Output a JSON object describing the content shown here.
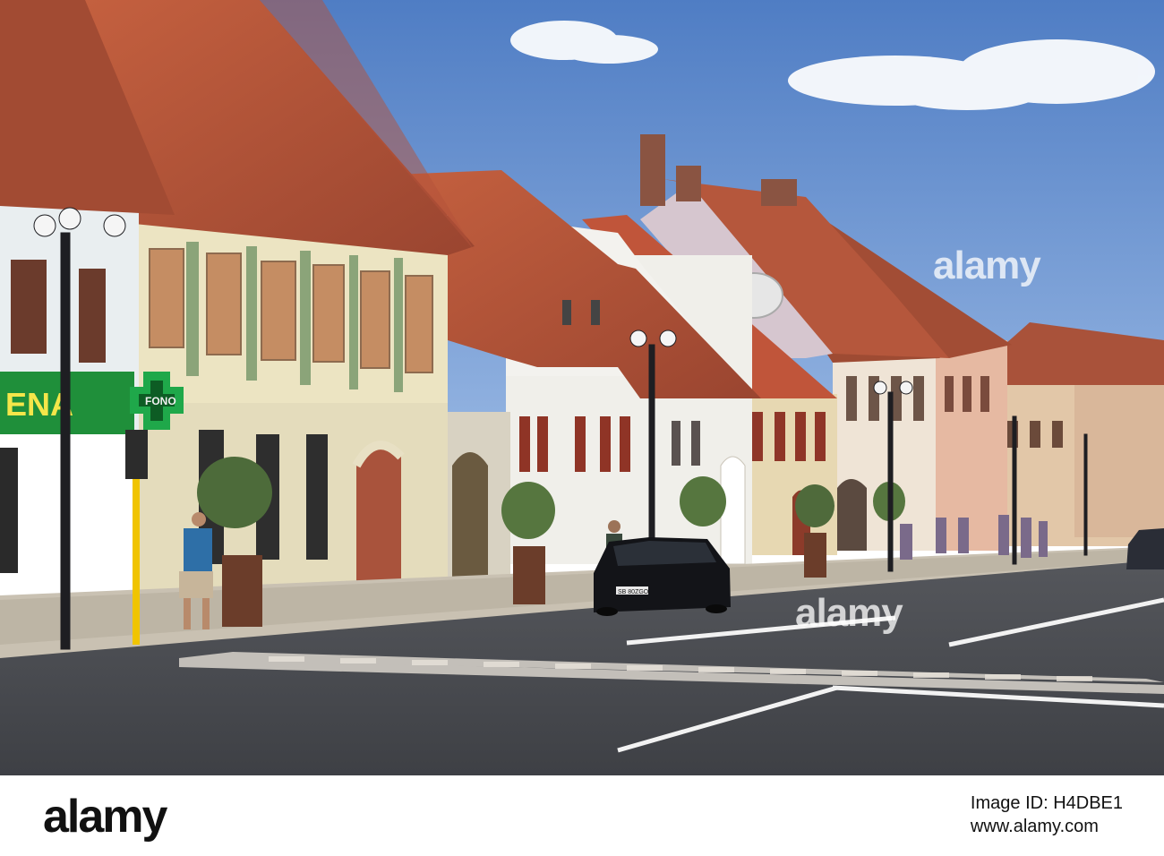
{
  "watermark": "alamy",
  "footer": {
    "logo": "alamy",
    "label": "Image ID:",
    "image_id": "H4DBE1",
    "site": "www.alamy.com"
  },
  "signs": {
    "shop": "ENA",
    "pharmacy": "FONO"
  },
  "car_plate": "SB 80ZGO",
  "colors": {
    "sky": "#5f88c8",
    "roof": "#b8553a",
    "asphalt": "#4a4c52",
    "pharmacy_cross": "#1fa84a"
  }
}
